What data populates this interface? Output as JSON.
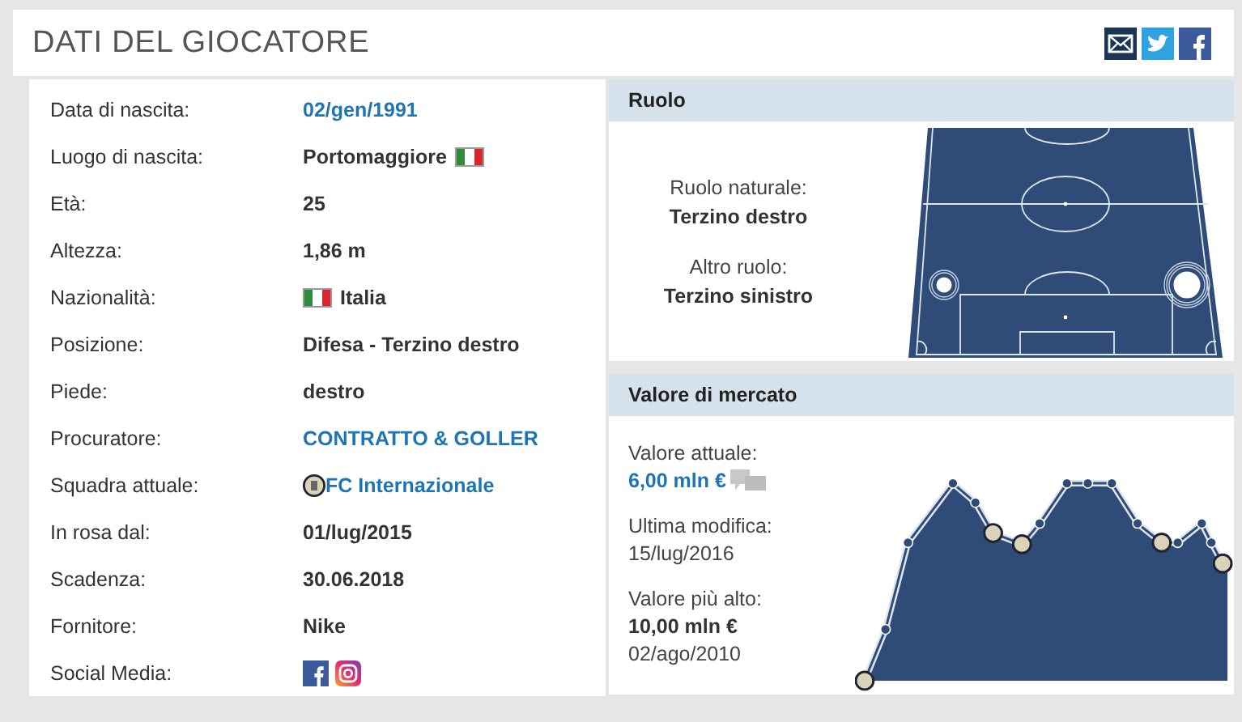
{
  "header": {
    "title": "DATI DEL GIOCATORE"
  },
  "details": [
    {
      "label": "Data di nascita:",
      "value": "02/gen/1991",
      "kind": "link"
    },
    {
      "label": "Luogo di nascita:",
      "value": "Portomaggiore",
      "kind": "flag_after"
    },
    {
      "label": "Età:",
      "value": "25",
      "kind": "text"
    },
    {
      "label": "Altezza:",
      "value": "1,86 m",
      "kind": "text"
    },
    {
      "label": "Nazionalità:",
      "value": "Italia",
      "kind": "flag_before"
    },
    {
      "label": "Posizione:",
      "value": "Difesa - Terzino destro",
      "kind": "text"
    },
    {
      "label": "Piede:",
      "value": "destro",
      "kind": "text"
    },
    {
      "label": "Procuratore:",
      "value": "CONTRATTO & GOLLER",
      "kind": "link"
    },
    {
      "label": "Squadra attuale:",
      "value": "FC Internazionale",
      "kind": "club_link"
    },
    {
      "label": "In rosa dal:",
      "value": "01/lug/2015",
      "kind": "text"
    },
    {
      "label": "Scadenza:",
      "value": "30.06.2018",
      "kind": "text"
    },
    {
      "label": "Fornitore:",
      "value": "Nike",
      "kind": "text"
    },
    {
      "label": "Social Media:",
      "kind": "social"
    }
  ],
  "role": {
    "title": "Ruolo",
    "natural_label": "Ruolo naturale:",
    "natural_value": "Terzino destro",
    "other_label": "Altro ruolo:",
    "other_value": "Terzino sinistro"
  },
  "market": {
    "title": "Valore di mercato",
    "current_label": "Valore attuale:",
    "current_value": "6,00 mln €",
    "updated_label": "Ultima modifica:",
    "updated_value": "15/lug/2016",
    "highest_label": "Valore più alto:",
    "highest_value": "10,00 mln €",
    "highest_date": "02/ago/2010"
  }
}
